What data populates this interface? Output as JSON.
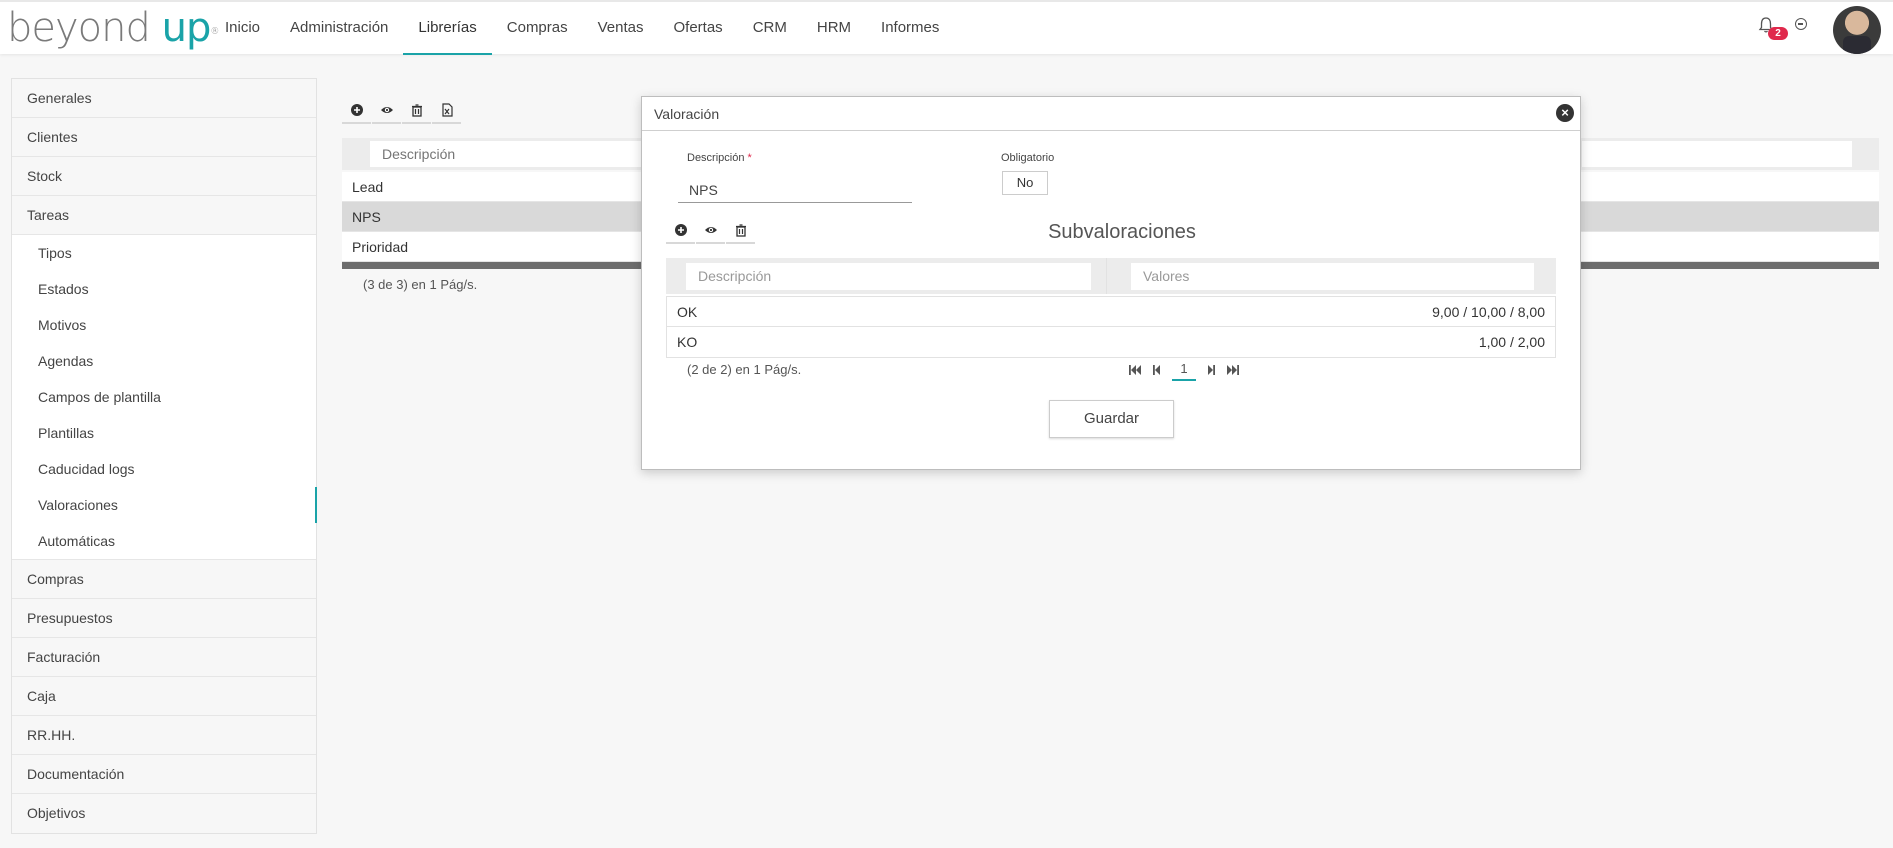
{
  "brand": {
    "logo_part1": "beyond",
    "logo_part2": "up",
    "logo_mark": "®"
  },
  "nav": {
    "items": [
      {
        "label": "Inicio"
      },
      {
        "label": "Administración"
      },
      {
        "label": "Librerías",
        "active": true
      },
      {
        "label": "Compras"
      },
      {
        "label": "Ventas"
      },
      {
        "label": "Ofertas"
      },
      {
        "label": "CRM"
      },
      {
        "label": "HRM"
      },
      {
        "label": "Informes"
      }
    ],
    "notification_count": "2",
    "icons": [
      "bell-icon",
      "user-menu-caret-icon"
    ]
  },
  "sidebar": {
    "top_items": [
      "Generales",
      "Clientes",
      "Stock",
      "Tareas"
    ],
    "sub_items": [
      "Tipos",
      "Estados",
      "Motivos",
      "Agendas",
      "Campos de plantilla",
      "Plantillas",
      "Caducidad logs",
      "Valoraciones",
      "Automáticas"
    ],
    "active_sub": "Valoraciones",
    "bottom_items": [
      "Compras",
      "Presupuestos",
      "Facturación",
      "Caja",
      "RR.HH.",
      "Documentación",
      "Objetivos"
    ]
  },
  "main": {
    "toolbar_icons": [
      "add-icon",
      "view-icon",
      "delete-icon",
      "excel-export-icon"
    ],
    "filter_placeholder": "Descripción",
    "rows": [
      {
        "label": "Lead",
        "selected": false
      },
      {
        "label": "NPS",
        "selected": true
      },
      {
        "label": "Prioridad",
        "selected": false
      }
    ],
    "pager_text": "(3 de 3) en 1 Pág/s."
  },
  "modal": {
    "title": "Valoración",
    "desc_label": "Descripción",
    "desc_required_mark": "*",
    "desc_value": "NPS",
    "oblig_label": "Obligatorio",
    "oblig_value": "No",
    "sub_title": "Subvaloraciones",
    "sub_toolbar_icons": [
      "add-icon",
      "view-icon",
      "delete-icon"
    ],
    "sub_col1_placeholder": "Descripción",
    "sub_col2_placeholder": "Valores",
    "sub_rows": [
      {
        "desc": "OK",
        "values": "9,00 / 10,00 / 8,00"
      },
      {
        "desc": "KO",
        "values": "1,00 / 2,00"
      }
    ],
    "sub_pager_text": "(2 de 2) en 1 Pág/s.",
    "page_number": "1",
    "save_label": "Guardar"
  }
}
